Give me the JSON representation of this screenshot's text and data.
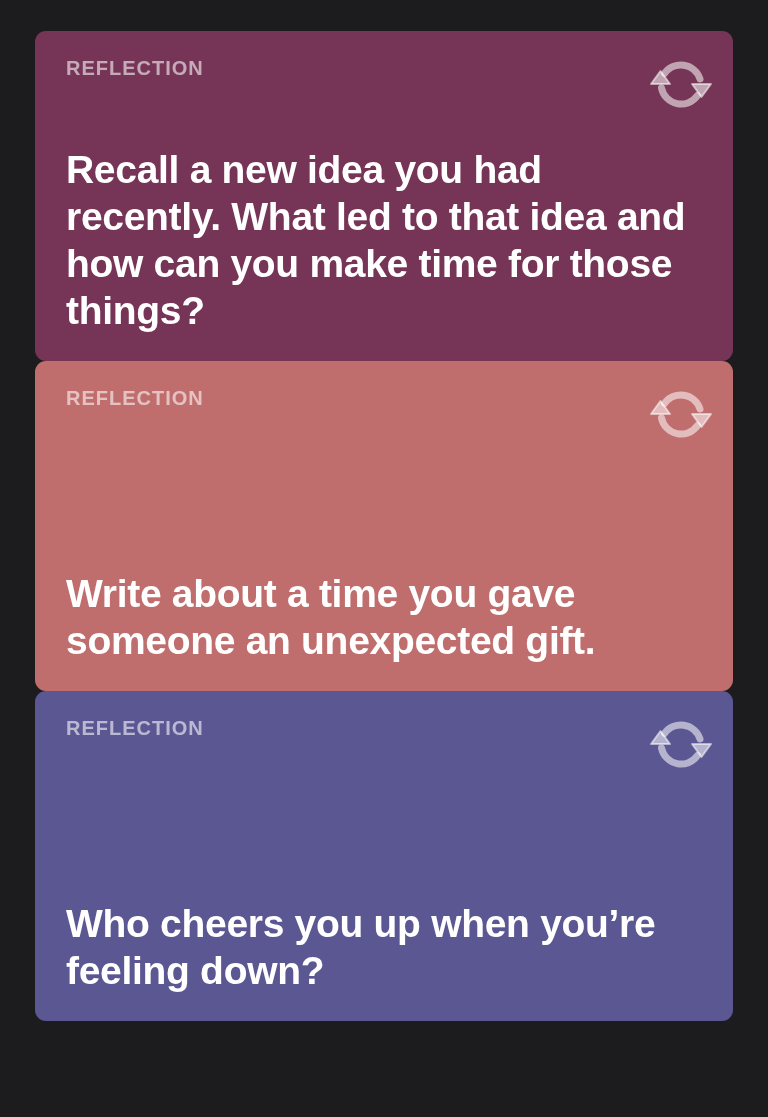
{
  "cards": [
    {
      "label": "REFLECTION",
      "prompt": "Recall a new idea you had recently. What led to that idea and how can you make time for those things?",
      "color": "#763556"
    },
    {
      "label": "REFLECTION",
      "prompt": "Write about a time you gave someone an unexpected gift.",
      "color": "#c06e6d"
    },
    {
      "label": "REFLECTION",
      "prompt": "Who cheers you up when you’re feeling down?",
      "color": "#5b5793"
    }
  ]
}
